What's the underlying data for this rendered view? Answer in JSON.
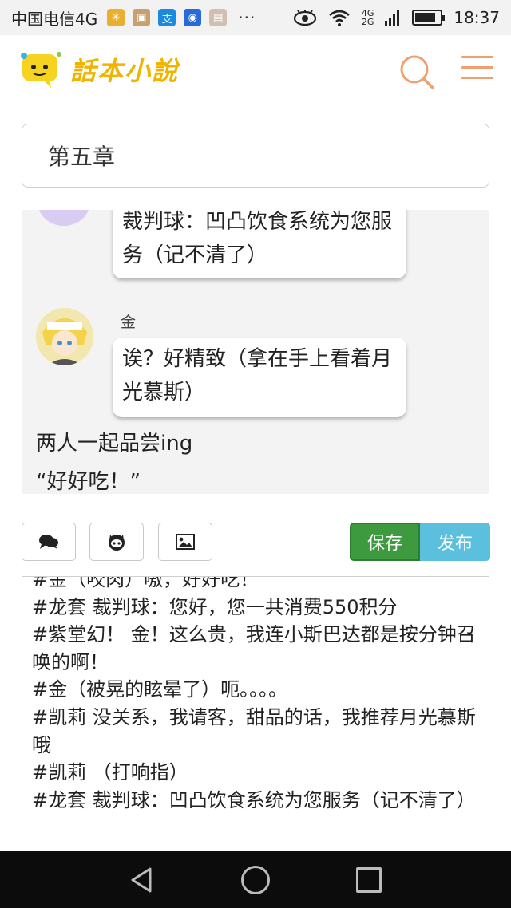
{
  "status_bar": {
    "carrier": "中国电信4G",
    "more": "···",
    "network_top": "4G",
    "network_bottom": "2G",
    "battery_level": 0.85,
    "time": "18:37"
  },
  "header": {
    "logo_text": "話本小說",
    "search_icon": "search-icon",
    "menu_icon": "menu-icon",
    "accent_color": "#f0a070"
  },
  "chapter": {
    "title_value": "第五章"
  },
  "preview": {
    "bubble1_text": "裁判球：凹凸饮食系统为您服务（记不清了）",
    "speaker_name": "金",
    "bubble2_text": "诶？好精致（拿在手上看着月光慕斯）",
    "narration1": "两人一起品尝ing",
    "narration2": "“好好吃！”"
  },
  "toolbar": {
    "chat_icon": "chat-bubbles-icon",
    "github_icon": "github-icon",
    "image_icon": "image-icon",
    "save_label": "保存",
    "publish_label": "发布",
    "save_color": "#3e9a3e",
    "publish_color": "#5bc0de"
  },
  "editor": {
    "lines": [
      "#金（咬肉）嗷，好好吃！",
      "#龙套 裁判球：您好，您一共消费550积分",
      "#紫堂幻！ 金！这么贵，我连小斯巴达都是按分钟召唤的啊！",
      "#金（被晃的眩晕了）呃。。。。",
      "#凯莉 没关系，我请客，甜品的话，我推荐月光慕斯哦",
      "#凯莉 （打响指）",
      "#龙套 裁判球：凹凸饮食系统为您服务（记不清了）"
    ]
  }
}
